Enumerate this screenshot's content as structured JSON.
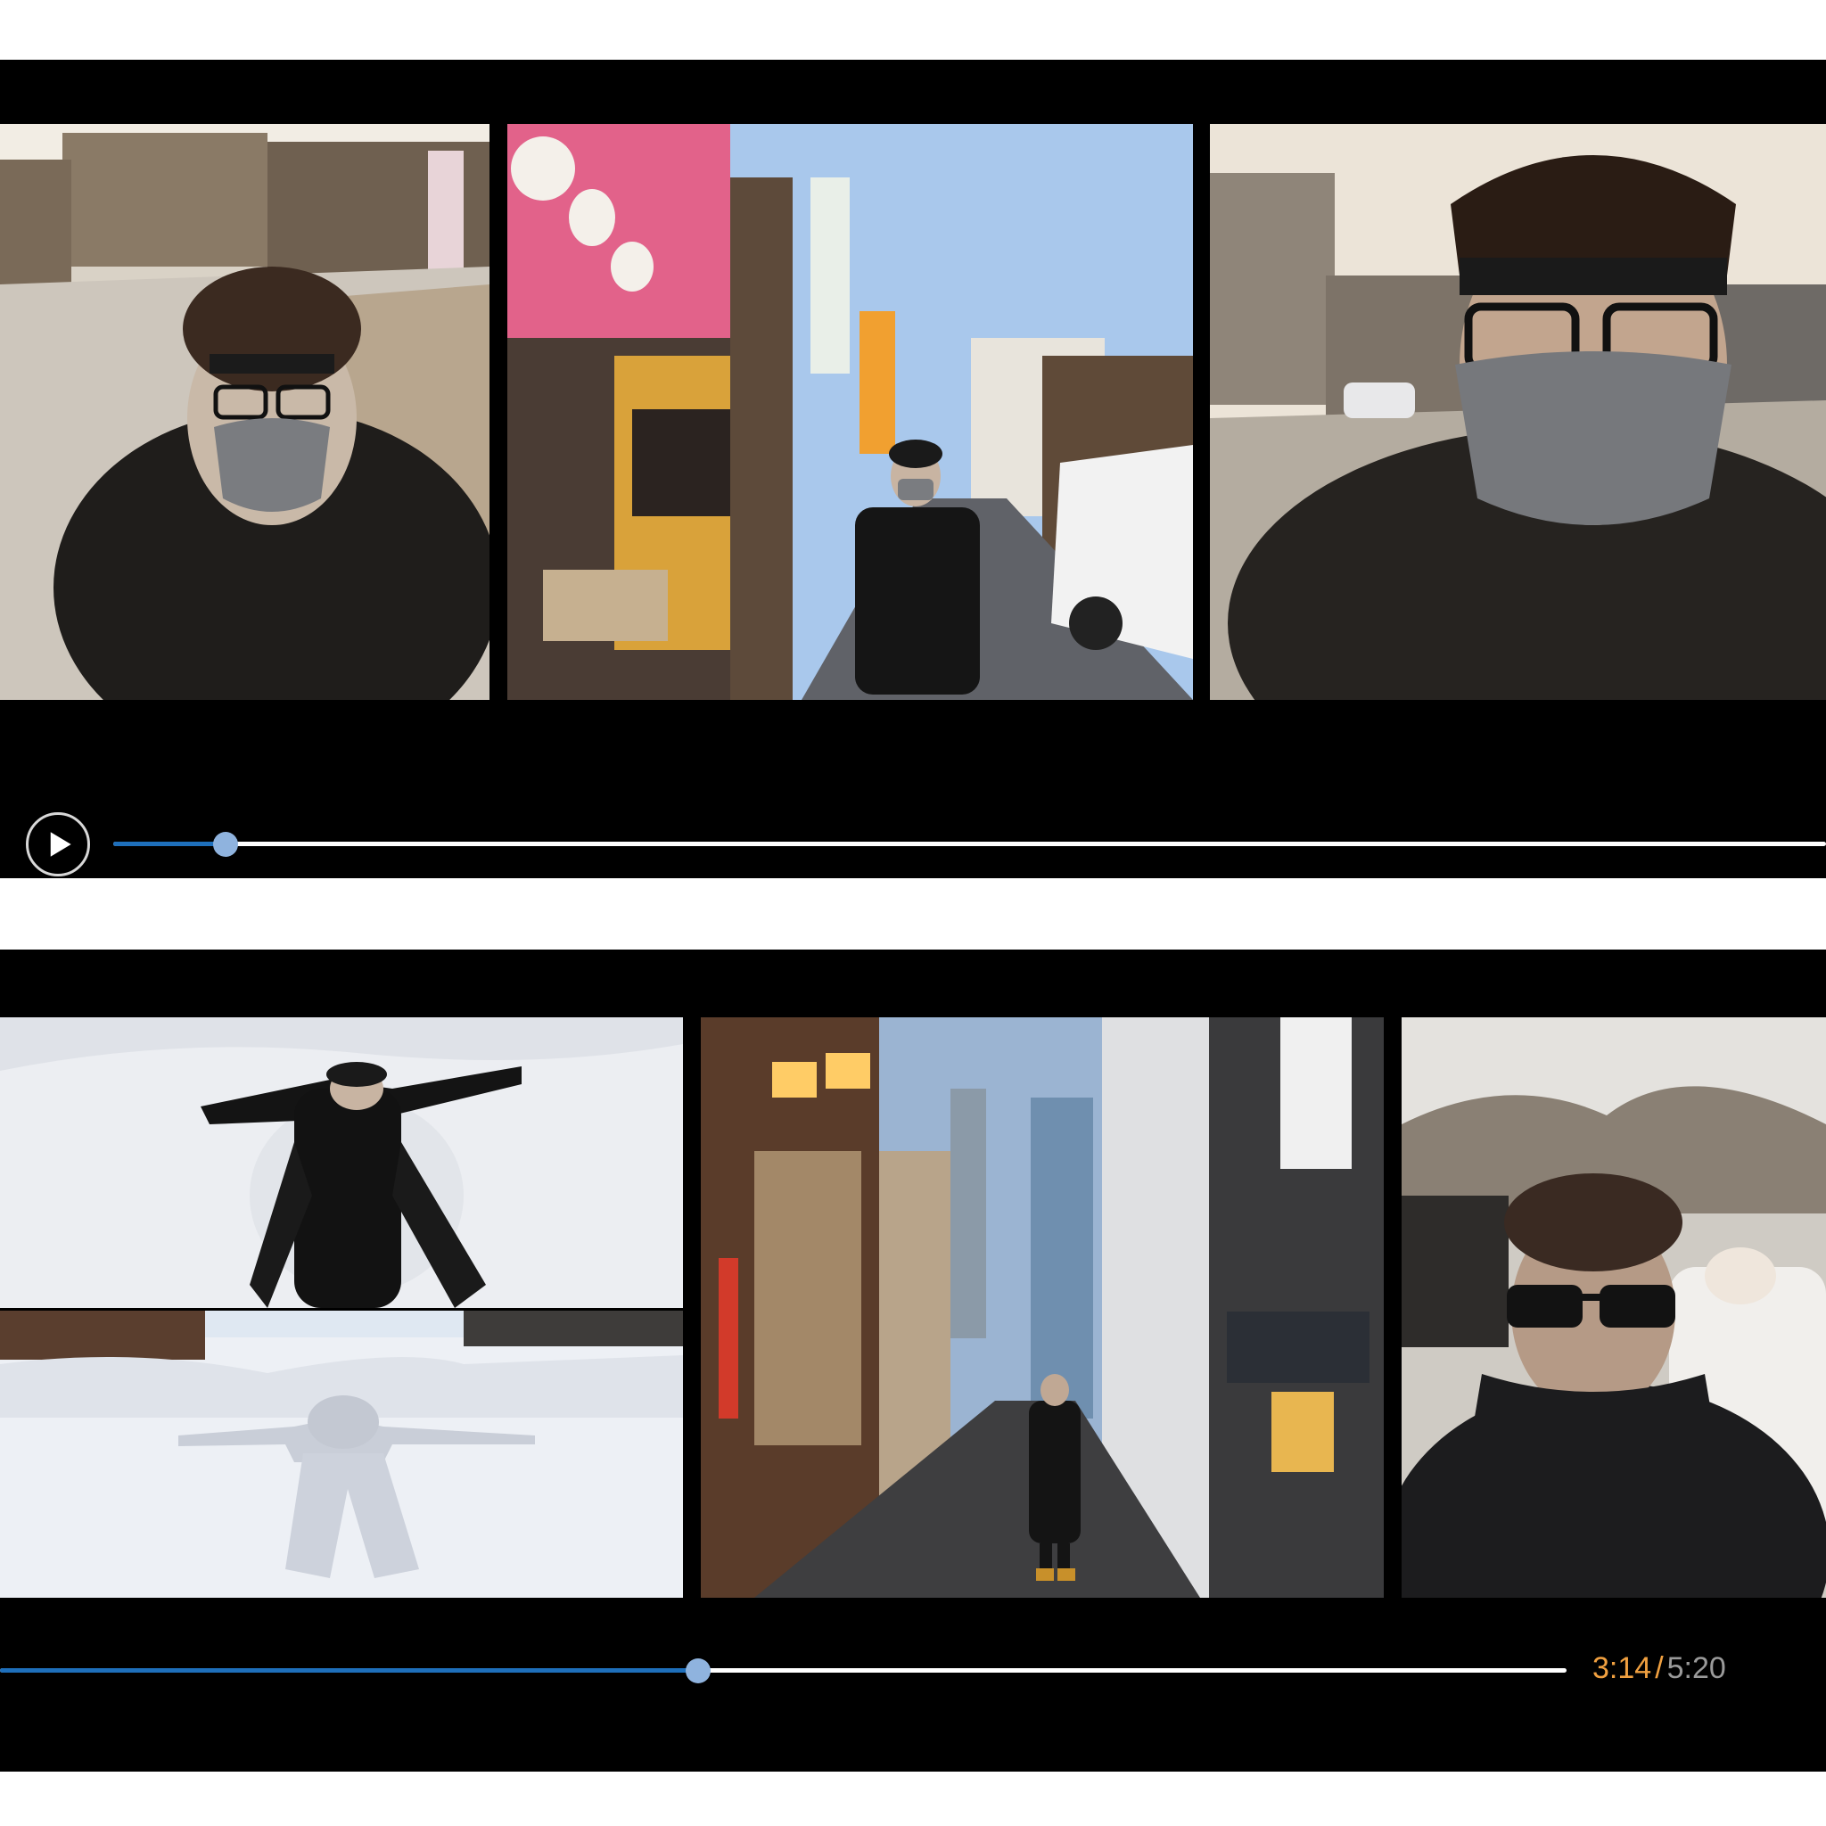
{
  "players": [
    {
      "name": "top",
      "controls": {
        "play_icon": "play-icon",
        "progress": 0.0655
      },
      "frames": [
        {
          "scene": "street-selfie-masked"
        },
        {
          "scene": "shop-street-standing"
        },
        {
          "scene": "street-closeup-selfie"
        }
      ]
    },
    {
      "name": "bottom",
      "controls": {
        "progress": 0.4455,
        "time_current": "3:14",
        "time_separator": "/",
        "time_total": "5:20"
      },
      "frames": [
        {
          "scene": "snow-angel-lying"
        },
        {
          "scene": "snow-angel-imprint"
        },
        {
          "scene": "evening-alley-standing"
        },
        {
          "scene": "volcanic-steam-selfie"
        }
      ]
    }
  ],
  "colors": {
    "progress_fill": "#1e6fbb",
    "track": "#ffffff",
    "thumb": "#8fb3de",
    "time_current": "#f0a040",
    "time_total": "#9a9a9a"
  }
}
